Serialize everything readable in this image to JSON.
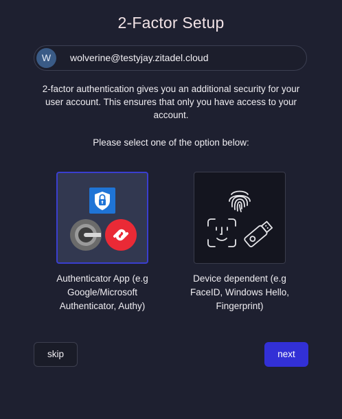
{
  "page": {
    "title": "2-Factor Setup"
  },
  "user": {
    "avatar_initial": "W",
    "email": "wolverine@testyjay.zitadel.cloud"
  },
  "description": {
    "line1": "2-factor authentication gives you an additional security for your",
    "line2": "user account. This ensures that only you have access to your",
    "line3": "account."
  },
  "prompt": "Please select one of the option below:",
  "options": [
    {
      "id": "authenticator-app",
      "selected": true,
      "label_lines": [
        "Authenticator App (e.g",
        "Google/Microsoft",
        "Authenticator, Authy)"
      ],
      "icons": [
        "microsoft-authenticator-icon",
        "google-authenticator-icon",
        "authy-icon"
      ]
    },
    {
      "id": "device-dependent",
      "selected": false,
      "label_lines": [
        "Device dependent (e.g",
        "FaceID, Windows Hello,",
        "Fingerprint)"
      ],
      "icons": [
        "fingerprint-icon",
        "face-id-icon",
        "usb-key-icon"
      ]
    }
  ],
  "buttons": {
    "skip": "skip",
    "next": "next"
  },
  "colors": {
    "background": "#1e2030",
    "accent": "#3230d6",
    "selected_border": "#3a3fd0"
  }
}
